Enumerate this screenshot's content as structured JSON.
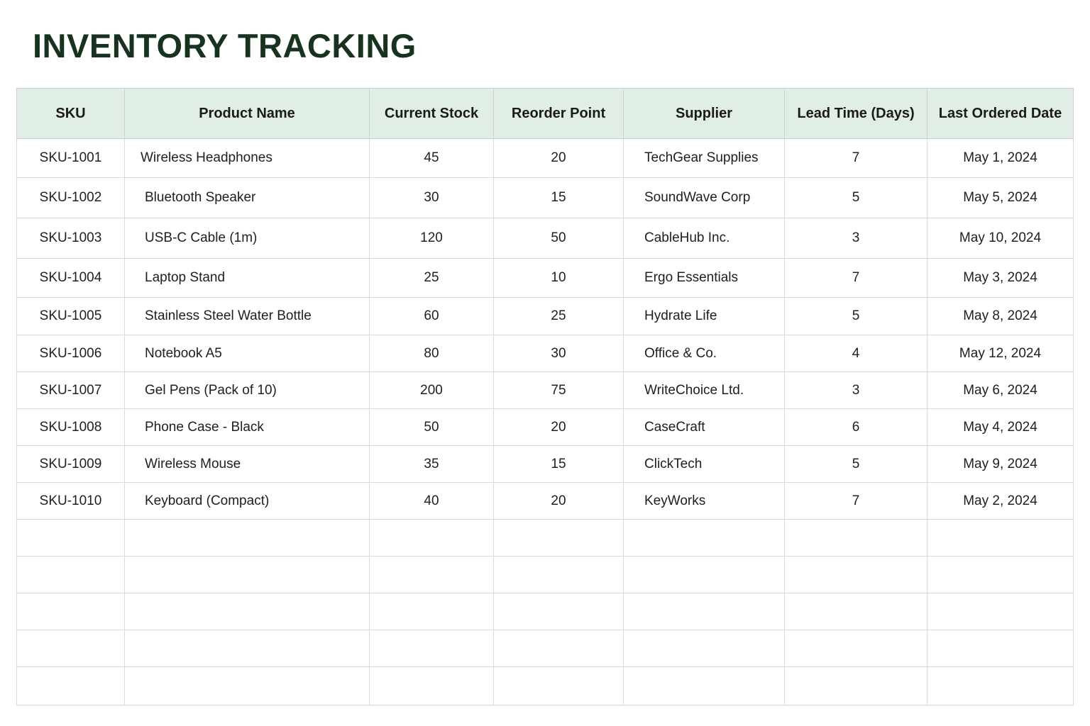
{
  "title": "INVENTORY TRACKING",
  "columns": [
    "SKU",
    "Product Name",
    "Current Stock",
    "Reorder Point",
    "Supplier",
    "Lead Time (Days)",
    "Last Ordered Date"
  ],
  "rows": [
    [
      "SKU-1001",
      "Wireless Headphones",
      "45",
      "20",
      "TechGear Supplies",
      "7",
      "May 1, 2024"
    ],
    [
      "SKU-1002",
      "Bluetooth Speaker",
      "30",
      "15",
      "SoundWave Corp",
      "5",
      "May 5, 2024"
    ],
    [
      "SKU-1003",
      "USB-C Cable (1m)",
      "120",
      "50",
      "CableHub Inc.",
      "3",
      "May 10, 2024"
    ],
    [
      "SKU-1004",
      "Laptop Stand",
      "25",
      "10",
      "Ergo Essentials",
      "7",
      "May 3, 2024"
    ],
    [
      "SKU-1005",
      "Stainless Steel Water Bottle",
      "60",
      "25",
      "Hydrate Life",
      "5",
      "May 8, 2024"
    ],
    [
      "SKU-1006",
      "Notebook A5",
      "80",
      "30",
      "Office & Co.",
      "4",
      "May 12, 2024"
    ],
    [
      "SKU-1007",
      "Gel Pens (Pack of 10)",
      "200",
      "75",
      "WriteChoice Ltd.",
      "3",
      "May 6, 2024"
    ],
    [
      "SKU-1008",
      "Phone Case - Black",
      "50",
      "20",
      "CaseCraft",
      "6",
      "May 4, 2024"
    ],
    [
      "SKU-1009",
      "Wireless Mouse",
      "35",
      "15",
      "ClickTech",
      "5",
      "May 9, 2024"
    ],
    [
      "SKU-1010",
      "Keyboard (Compact)",
      "40",
      "20",
      "KeyWorks",
      "7",
      "May 2, 2024"
    ]
  ],
  "colors": {
    "title": "#17331f",
    "header_bg": "#e1eee5",
    "grid": "#d6dcd8"
  }
}
